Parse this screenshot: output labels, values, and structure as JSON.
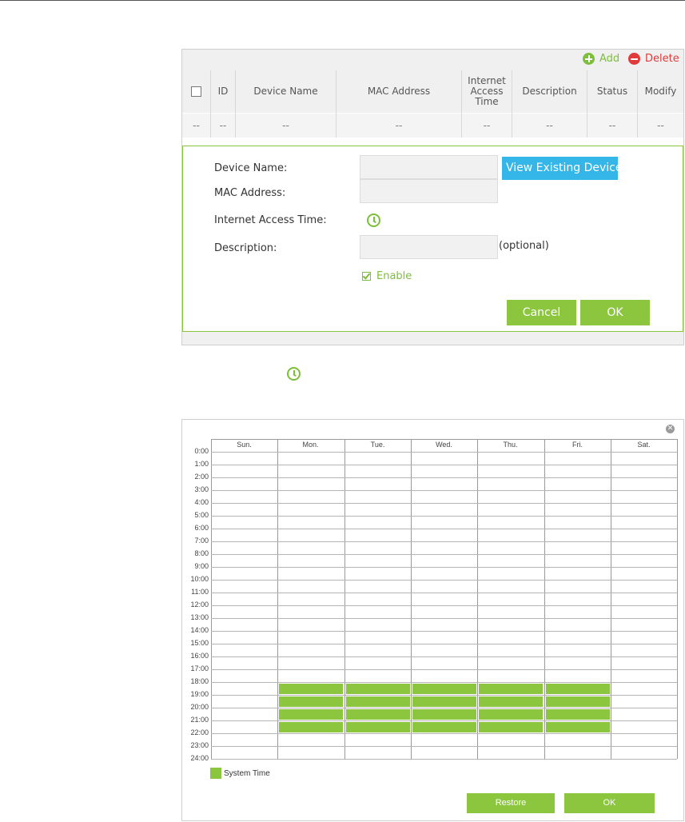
{
  "colors": {
    "accent_green": "#8cc63f",
    "icon_green": "#7cbf3b",
    "delete_red": "#e03a3a",
    "info_blue": "#34b6e8"
  },
  "toolbar": {
    "add_label": "Add",
    "delete_label": "Delete"
  },
  "table": {
    "headers": [
      "ID",
      "Device Name",
      "MAC Address",
      "Internet Access Time",
      "Description",
      "Status",
      "Modify"
    ],
    "empty_row": [
      "--",
      "--",
      "--",
      "--",
      "--",
      "--",
      "--",
      "--"
    ]
  },
  "form": {
    "device_name_label": "Device Name:",
    "mac_address_label": "MAC Address:",
    "access_time_label": "Internet Access Time:",
    "description_label": "Description:",
    "view_devices_label": "View Existing Devices",
    "optional_label": "(optional)",
    "enable_label": "Enable",
    "cancel_label": "Cancel",
    "ok_label": "OK"
  },
  "schedule": {
    "days": [
      "Sun.",
      "Mon.",
      "Tue.",
      "Wed.",
      "Thu.",
      "Fri.",
      "Sat."
    ],
    "hours": [
      "0:00",
      "1:00",
      "2:00",
      "3:00",
      "4:00",
      "5:00",
      "6:00",
      "7:00",
      "8:00",
      "9:00",
      "10:00",
      "11:00",
      "12:00",
      "13:00",
      "14:00",
      "15:00",
      "16:00",
      "17:00",
      "18:00",
      "19:00",
      "20:00",
      "21:00",
      "22:00",
      "23:00",
      "24:00"
    ],
    "selected_days": [
      "Mon.",
      "Tue.",
      "Wed.",
      "Thu.",
      "Fri."
    ],
    "selected_from": "18:00",
    "selected_to": "22:00",
    "legend_label": "System Time",
    "restore_label": "Restore",
    "ok_label": "OK"
  }
}
